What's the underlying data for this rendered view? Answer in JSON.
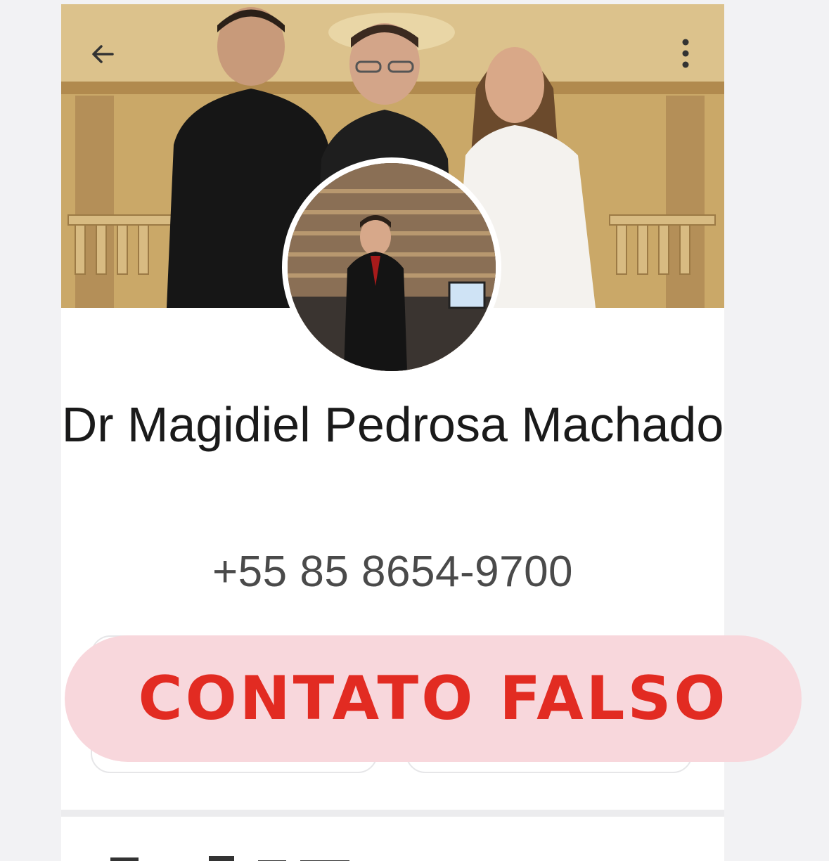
{
  "profile": {
    "name": "Dr Magidiel Pedrosa Machado",
    "phone": "+55 85 8654-9700"
  },
  "cover": {
    "description_icon": "cover-photo"
  },
  "header": {
    "back_icon": "arrow-left-icon",
    "menu_icon": "more-vertical-icon"
  },
  "actions": [
    {
      "name": "action-button-1"
    },
    {
      "name": "action-button-2"
    }
  ],
  "warning": {
    "label": "CONTATO FALSO",
    "background": "#f8d7dc",
    "color": "#e22b22"
  }
}
